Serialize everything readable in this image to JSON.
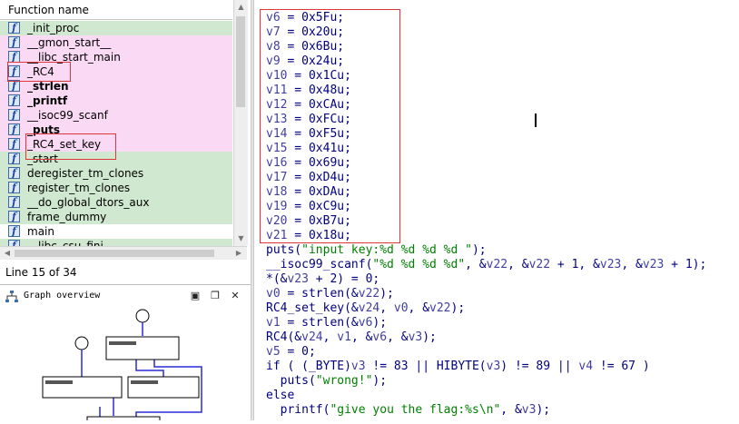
{
  "function_panel": {
    "header": "Function name",
    "functions": [
      {
        "name": "_init_proc",
        "bg": "#cfe8cf",
        "bold": false
      },
      {
        "name": "__gmon_start__",
        "bg": "#f9d9f3",
        "bold": false
      },
      {
        "name": "__libc_start_main",
        "bg": "#f9d9f3",
        "bold": false
      },
      {
        "name": "_RC4",
        "bg": "#f9d9f3",
        "bold": false
      },
      {
        "name": "_strlen",
        "bg": "#f9d9f3",
        "bold": true
      },
      {
        "name": "_printf",
        "bg": "#f9d9f3",
        "bold": true
      },
      {
        "name": "__isoc99_scanf",
        "bg": "#f9d9f3",
        "bold": false
      },
      {
        "name": "_puts",
        "bg": "#f9d9f3",
        "bold": true
      },
      {
        "name": "_RC4_set_key",
        "bg": "#f9d9f3",
        "bold": false
      },
      {
        "name": "_start",
        "bg": "#cfe8cf",
        "bold": false
      },
      {
        "name": "deregister_tm_clones",
        "bg": "#cfe8cf",
        "bold": false
      },
      {
        "name": "register_tm_clones",
        "bg": "#cfe8cf",
        "bold": false
      },
      {
        "name": "__do_global_dtors_aux",
        "bg": "#cfe8cf",
        "bold": false
      },
      {
        "name": "frame_dummy",
        "bg": "#cfe8cf",
        "bold": false
      },
      {
        "name": "main",
        "bg": "#ffffff",
        "bold": false
      },
      {
        "name": "__libc_csu_fini",
        "bg": "#cfe8cf",
        "bold": false
      }
    ],
    "function_icon": "f",
    "status": "Line 15 of 34"
  },
  "graph_overview": {
    "title": "Graph overview",
    "icon": "graph-icon",
    "buttons": [
      "close-icon",
      "restore-icon",
      "close-x-icon"
    ]
  },
  "code_lines": [
    [
      [
        "v",
        "v6"
      ],
      [
        "n",
        " = 0x5Fu;"
      ]
    ],
    [
      [
        "v",
        "v7"
      ],
      [
        "n",
        " = 0x20u;"
      ]
    ],
    [
      [
        "v",
        "v8"
      ],
      [
        "n",
        " = 0x6Bu;"
      ]
    ],
    [
      [
        "v",
        "v9"
      ],
      [
        "n",
        " = 0x24u;"
      ]
    ],
    [
      [
        "v",
        "v10"
      ],
      [
        "n",
        " = 0x1Cu;"
      ]
    ],
    [
      [
        "v",
        "v11"
      ],
      [
        "n",
        " = 0x48u;"
      ]
    ],
    [
      [
        "v",
        "v12"
      ],
      [
        "n",
        " = 0xCAu;"
      ]
    ],
    [
      [
        "v",
        "v13"
      ],
      [
        "n",
        " = 0xFCu;"
      ]
    ],
    [
      [
        "v",
        "v14"
      ],
      [
        "n",
        " = 0xF5u;"
      ]
    ],
    [
      [
        "v",
        "v15"
      ],
      [
        "n",
        " = 0x41u;"
      ]
    ],
    [
      [
        "v",
        "v16"
      ],
      [
        "n",
        " = 0x69u;"
      ]
    ],
    [
      [
        "v",
        "v17"
      ],
      [
        "n",
        " = 0xD4u;"
      ]
    ],
    [
      [
        "v",
        "v18"
      ],
      [
        "n",
        " = 0xDAu;"
      ]
    ],
    [
      [
        "v",
        "v19"
      ],
      [
        "n",
        " = 0xC9u;"
      ]
    ],
    [
      [
        "v",
        "v20"
      ],
      [
        "n",
        " = 0xB7u;"
      ]
    ],
    [
      [
        "v",
        "v21"
      ],
      [
        "n",
        " = 0x18u;"
      ]
    ],
    [
      [
        "f",
        "puts("
      ],
      [
        "s",
        "\"input key:%d %d %d %d \""
      ],
      [
        "n",
        ");"
      ]
    ],
    [
      [
        "f",
        "__isoc99_scanf("
      ],
      [
        "s",
        "\"%d %d %d %d\""
      ],
      [
        "n",
        ", &"
      ],
      [
        "v",
        "v22"
      ],
      [
        "n",
        ", &"
      ],
      [
        "v",
        "v22"
      ],
      [
        "n",
        " + 1, &"
      ],
      [
        "v",
        "v23"
      ],
      [
        "n",
        ", &"
      ],
      [
        "v",
        "v23"
      ],
      [
        "n",
        " + 1);"
      ]
    ],
    [
      [
        "n",
        "*(&"
      ],
      [
        "v",
        "v23"
      ],
      [
        "n",
        " + 2) = 0;"
      ]
    ],
    [
      [
        "v",
        "v0"
      ],
      [
        "n",
        " = strlen(&"
      ],
      [
        "v",
        "v22"
      ],
      [
        "n",
        ");"
      ]
    ],
    [
      [
        "f",
        "RC4_set_key(&"
      ],
      [
        "v",
        "v24"
      ],
      [
        "n",
        ", "
      ],
      [
        "v",
        "v0"
      ],
      [
        "n",
        ", &"
      ],
      [
        "v",
        "v22"
      ],
      [
        "n",
        ");"
      ]
    ],
    [
      [
        "v",
        "v1"
      ],
      [
        "n",
        " = strlen(&"
      ],
      [
        "v",
        "v6"
      ],
      [
        "n",
        ");"
      ]
    ],
    [
      [
        "f",
        "RC4(&"
      ],
      [
        "v",
        "v24"
      ],
      [
        "n",
        ", "
      ],
      [
        "v",
        "v1"
      ],
      [
        "n",
        ", &"
      ],
      [
        "v",
        "v6"
      ],
      [
        "n",
        ", &"
      ],
      [
        "v",
        "v3"
      ],
      [
        "n",
        ");"
      ]
    ],
    [
      [
        "v",
        "v5"
      ],
      [
        "n",
        " = 0;"
      ]
    ],
    [
      [
        "k",
        "if ( (_BYTE)"
      ],
      [
        "v",
        "v3"
      ],
      [
        "n",
        " != 83 || HIBYTE("
      ],
      [
        "v",
        "v3"
      ],
      [
        "n",
        ") != 89 || "
      ],
      [
        "v",
        "v4"
      ],
      [
        "n",
        " != 67 )"
      ]
    ],
    [
      [
        "n",
        "  puts("
      ],
      [
        "s",
        "\"wrong!\""
      ],
      [
        "n",
        ");"
      ]
    ],
    [
      [
        "k",
        "else"
      ]
    ],
    [
      [
        "n",
        "  printf("
      ],
      [
        "s",
        "\"give you the flag:%s\\n\""
      ],
      [
        "n",
        ", &"
      ],
      [
        "v",
        "v3"
      ],
      [
        "n",
        ");"
      ]
    ]
  ]
}
